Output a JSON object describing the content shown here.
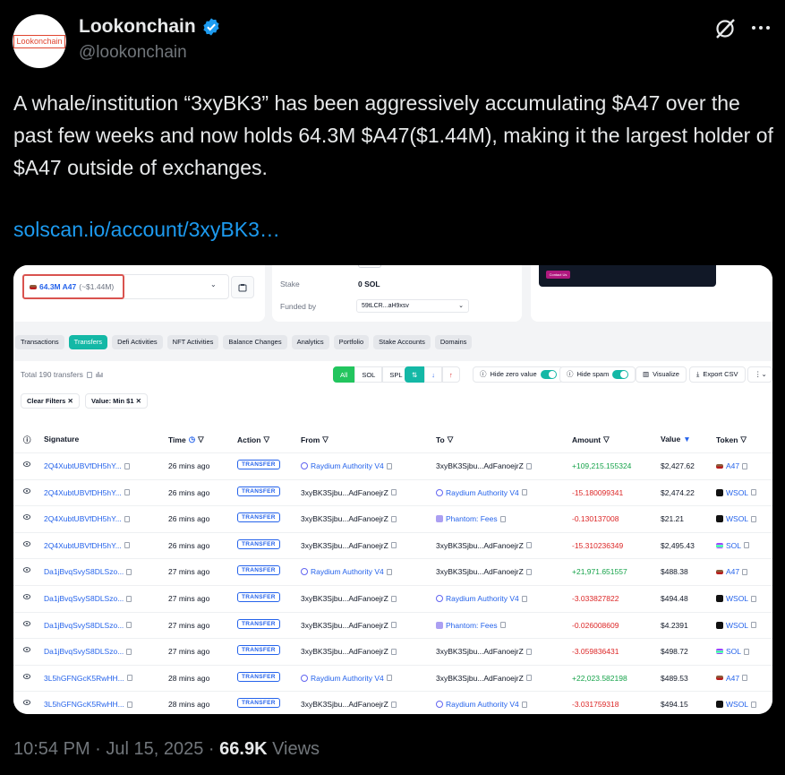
{
  "author": {
    "name": "Lookonchain",
    "handle": "@lookonchain",
    "avatar_text": "Lookonchain"
  },
  "tweet": {
    "text": "A whale/institution “3xyBK3” has been aggressively accumulating $A47 over the past few weeks and now holds 64.3M $A47($1.44M), making it the largest holder of $A47 outside of exchanges.",
    "link": "solscan.io/account/3xyBK3…",
    "time": "10:54 PM · Jul 15, 2025 · ",
    "views_count": "66.9K",
    "views_label": " Views"
  },
  "screenshot": {
    "holding": {
      "amount": "64.3M A47",
      "usd": "(~$1.44M)"
    },
    "stake_label": "Stake",
    "stake_value": "0 SOL",
    "funded_label": "Funded by",
    "funded_value": "59tLCR...aH9xsv",
    "contact_label": "Contact Us",
    "tabs": [
      "Transactions",
      "Transfers",
      "Defi Activities",
      "NFT Activities",
      "Balance Changes",
      "Analytics",
      "Portfolio",
      "Stake Accounts",
      "Domains"
    ],
    "active_tab": "Transfers",
    "total_text": "Total 190 transfers",
    "filters": {
      "all": "All",
      "sol": "SOL",
      "spl": "SPL",
      "hide_zero": "Hide zero value",
      "hide_spam": "Hide spam",
      "visualize": "Visualize",
      "export": "Export CSV"
    },
    "chips": {
      "clear": "Clear Filters",
      "value": "Value: Min $1"
    },
    "headers": {
      "signature": "Signature",
      "time": "Time",
      "action": "Action",
      "from": "From",
      "to": "To",
      "amount": "Amount",
      "value": "Value",
      "token": "Token"
    },
    "rows": [
      {
        "sig": "2Q4XubtUBVfDH5hY...",
        "time": "26 mins ago",
        "action": "TRANSFER",
        "from": "Raydium Authority V4",
        "from_type": "raydium",
        "to": "3xyBK3Sjbu...AdFanoejrZ",
        "to_type": "plain",
        "amount": "+109,215.155324",
        "sign": "pos",
        "value": "$2,427.62",
        "token": "A47",
        "tok": "a47"
      },
      {
        "sig": "2Q4XubtUBVfDH5hY...",
        "time": "26 mins ago",
        "action": "TRANSFER",
        "from": "3xyBK3Sjbu...AdFanoejrZ",
        "from_type": "plain",
        "to": "Raydium Authority V4",
        "to_type": "raydium",
        "amount": "-15.180099341",
        "sign": "neg",
        "value": "$2,474.22",
        "token": "WSOL",
        "tok": "wsol"
      },
      {
        "sig": "2Q4XubtUBVfDH5hY...",
        "time": "26 mins ago",
        "action": "TRANSFER",
        "from": "3xyBK3Sjbu...AdFanoejrZ",
        "from_type": "plain",
        "to": "Phantom: Fees",
        "to_type": "phantom",
        "amount": "-0.130137008",
        "sign": "neg",
        "value": "$21.21",
        "token": "WSOL",
        "tok": "wsol"
      },
      {
        "sig": "2Q4XubtUBVfDH5hY...",
        "time": "26 mins ago",
        "action": "TRANSFER",
        "from": "3xyBK3Sjbu...AdFanoejrZ",
        "from_type": "plain",
        "to": "3xyBK3Sjbu...AdFanoejrZ",
        "to_type": "plain",
        "amount": "-15.310236349",
        "sign": "neg",
        "value": "$2,495.43",
        "token": "SOL",
        "tok": "sol"
      },
      {
        "sig": "Da1jBvqSvyS8DLSzo...",
        "time": "27 mins ago",
        "action": "TRANSFER",
        "from": "Raydium Authority V4",
        "from_type": "raydium",
        "to": "3xyBK3Sjbu...AdFanoejrZ",
        "to_type": "plain",
        "amount": "+21,971.651557",
        "sign": "pos",
        "value": "$488.38",
        "token": "A47",
        "tok": "a47"
      },
      {
        "sig": "Da1jBvqSvyS8DLSzo...",
        "time": "27 mins ago",
        "action": "TRANSFER",
        "from": "3xyBK3Sjbu...AdFanoejrZ",
        "from_type": "plain",
        "to": "Raydium Authority V4",
        "to_type": "raydium",
        "amount": "-3.033827822",
        "sign": "neg",
        "value": "$494.48",
        "token": "WSOL",
        "tok": "wsol"
      },
      {
        "sig": "Da1jBvqSvyS8DLSzo...",
        "time": "27 mins ago",
        "action": "TRANSFER",
        "from": "3xyBK3Sjbu...AdFanoejrZ",
        "from_type": "plain",
        "to": "Phantom: Fees",
        "to_type": "phantom",
        "amount": "-0.026008609",
        "sign": "neg",
        "value": "$4.2391",
        "token": "WSOL",
        "tok": "wsol"
      },
      {
        "sig": "Da1jBvqSvyS8DLSzo...",
        "time": "27 mins ago",
        "action": "TRANSFER",
        "from": "3xyBK3Sjbu...AdFanoejrZ",
        "from_type": "plain",
        "to": "3xyBK3Sjbu...AdFanoejrZ",
        "to_type": "plain",
        "amount": "-3.059836431",
        "sign": "neg",
        "value": "$498.72",
        "token": "SOL",
        "tok": "sol"
      },
      {
        "sig": "3L5hGFNGcK5RwHH...",
        "time": "28 mins ago",
        "action": "TRANSFER",
        "from": "Raydium Authority V4",
        "from_type": "raydium",
        "to": "3xyBK3Sjbu...AdFanoejrZ",
        "to_type": "plain",
        "amount": "+22,023.582198",
        "sign": "pos",
        "value": "$489.53",
        "token": "A47",
        "tok": "a47"
      },
      {
        "sig": "3L5hGFNGcK5RwHH...",
        "time": "28 mins ago",
        "action": "TRANSFER",
        "from": "3xyBK3Sjbu...AdFanoejrZ",
        "from_type": "plain",
        "to": "Raydium Authority V4",
        "to_type": "raydium",
        "amount": "-3.031759318",
        "sign": "neg",
        "value": "$494.15",
        "token": "WSOL",
        "tok": "wsol"
      }
    ]
  },
  "colors": {
    "link_blue": "#1d9bf0",
    "verified_blue": "#1d9bf0",
    "teal_accent": "#14b8a6",
    "positive": "#16a34a",
    "negative": "#dc2626",
    "highlight_red": "#d9534f"
  }
}
